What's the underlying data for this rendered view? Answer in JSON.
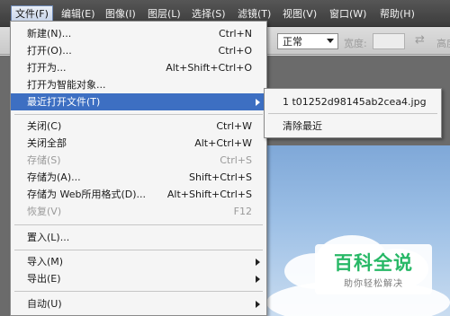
{
  "menubar": {
    "items": [
      {
        "label": "文件(F)"
      },
      {
        "label": "编辑(E)"
      },
      {
        "label": "图像(I)"
      },
      {
        "label": "图层(L)"
      },
      {
        "label": "选择(S)"
      },
      {
        "label": "滤镜(T)"
      },
      {
        "label": "视图(V)"
      },
      {
        "label": "窗口(W)"
      },
      {
        "label": "帮助(H)"
      }
    ]
  },
  "options": {
    "style_value": "正常",
    "width_label": "宽度:",
    "swap_glyph": "⇄",
    "height_label": "高度"
  },
  "file_menu": {
    "items": [
      {
        "label": "新建(N)...",
        "shortcut": "Ctrl+N"
      },
      {
        "label": "打开(O)...",
        "shortcut": "Ctrl+O"
      },
      {
        "label": "打开为...",
        "shortcut": "Alt+Shift+Ctrl+O"
      },
      {
        "label": "打开为智能对象..."
      },
      {
        "label": "最近打开文件(T)"
      },
      {
        "label": "关闭(C)",
        "shortcut": "Ctrl+W"
      },
      {
        "label": "关闭全部",
        "shortcut": "Alt+Ctrl+W"
      },
      {
        "label": "存储(S)",
        "shortcut": "Ctrl+S"
      },
      {
        "label": "存储为(A)...",
        "shortcut": "Shift+Ctrl+S"
      },
      {
        "label": "存储为 Web所用格式(D)...",
        "shortcut": "Alt+Shift+Ctrl+S"
      },
      {
        "label": "恢复(V)",
        "shortcut": "F12"
      },
      {
        "label": "置入(L)..."
      },
      {
        "label": "导入(M)"
      },
      {
        "label": "导出(E)"
      },
      {
        "label": "自动(U)"
      }
    ]
  },
  "recent_submenu": {
    "file": "1 t01252d98145ab2cea4.jpg",
    "clear": "清除最近"
  },
  "watermark": {
    "title": "百科全说",
    "subtitle": "助你轻松解决"
  },
  "colors": {
    "highlight": "#3d6fc2",
    "menubar": "#4a4a4a",
    "watermark_green": "#27b866"
  }
}
